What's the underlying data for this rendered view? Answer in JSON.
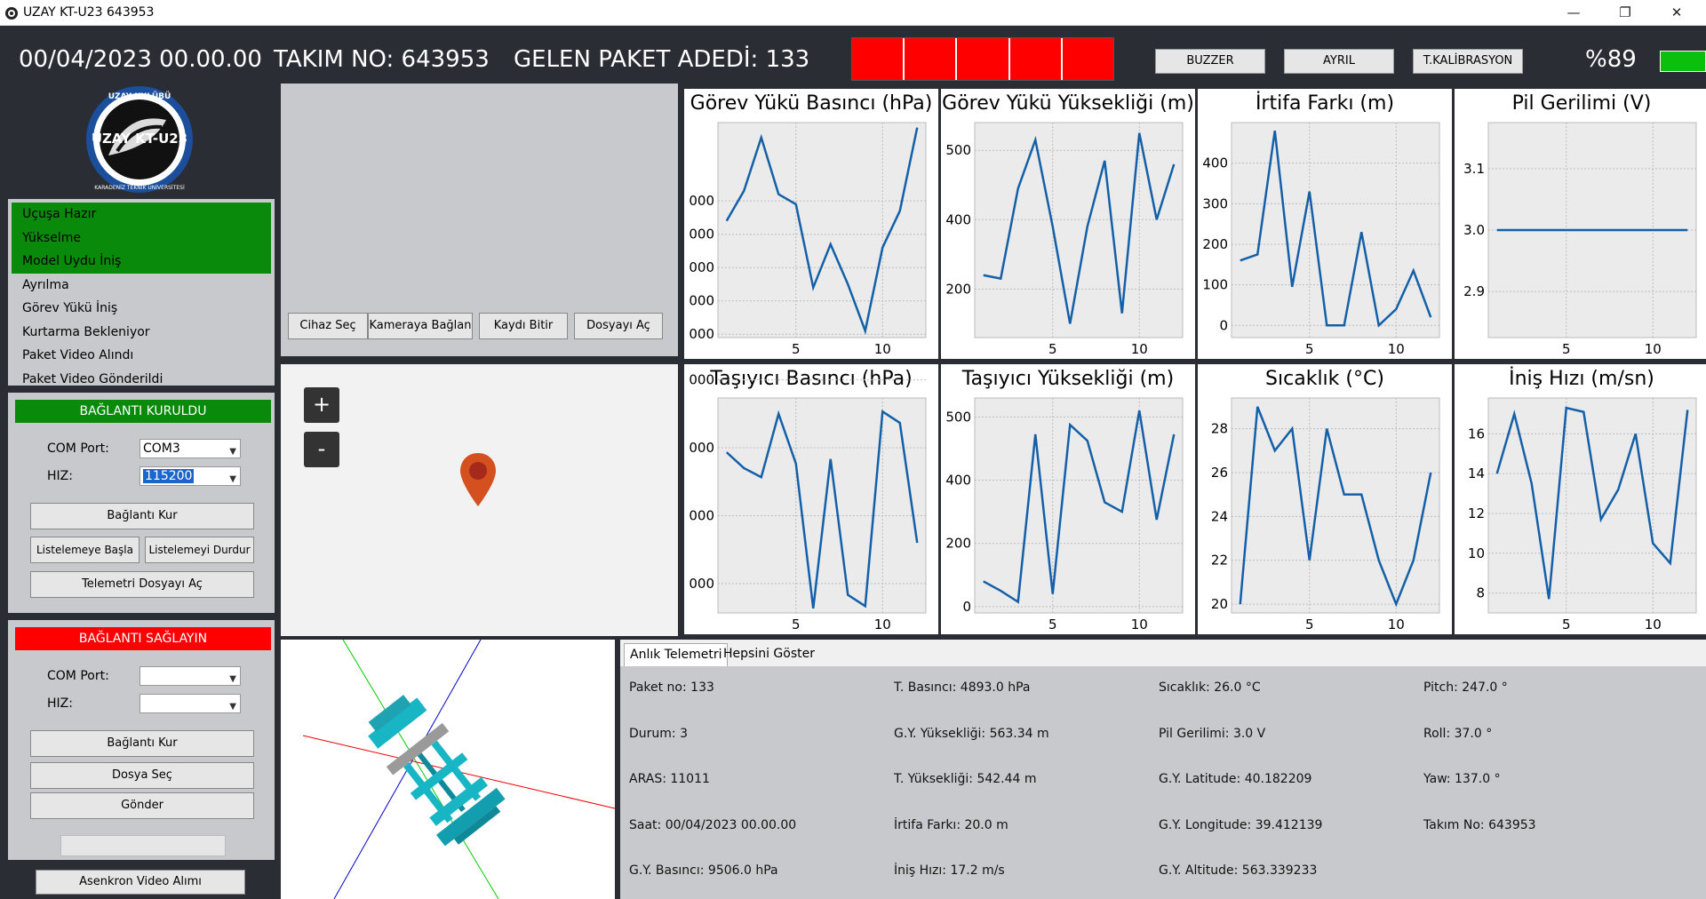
{
  "window": {
    "title": "UZAY KT-U23 643953",
    "minimize": "—",
    "restore": "❐",
    "close": "✕"
  },
  "header": {
    "datetime": "00/04/2023 00.00.00",
    "team": "TAKIM NO: 643953",
    "packets": "GELEN PAKET ADEDİ: 133",
    "buttons": {
      "buzzer": "BUZZER",
      "separate": "AYRIL",
      "calibration": "T.KALİBRASYON"
    },
    "battery": "%89",
    "status_color": "#ff0000",
    "battery_color": "#0cbf0c"
  },
  "logo": {
    "top_text": "UZAY KULÜBÜ",
    "main_text": "UZAY KT-U23",
    "ring_text": "KARADENİZ TEKNİK ÜNİVERSİTESİ"
  },
  "flight_status": {
    "items": [
      "Uçuşa Hazır",
      "Yükselme",
      "Model Uydu İniş",
      "Ayrılma",
      "Görev Yükü İniş",
      "Kurtarma Bekleniyor",
      "Paket Video Alındı",
      "Paket Video Gönderildi"
    ],
    "active_count": 3,
    "active_color": "#0a8a0a"
  },
  "connection1": {
    "status": "BAĞLANTI KURULDU",
    "status_color": "#0a8a0a",
    "com_label": "COM Port:",
    "com_value": "COM3",
    "speed_label": "HIZ:",
    "speed_value": "115200",
    "connect": "Bağlantı Kur",
    "start_list": "Listelemeye Başla",
    "stop_list": "Listelemeyi Durdur",
    "open_file": "Telemetri Dosyayı Aç"
  },
  "connection2": {
    "status": "BAĞLANTI SAĞLAYIN",
    "status_color": "#ff0000",
    "com_label": "COM Port:",
    "com_value": "",
    "speed_label": "HIZ:",
    "speed_value": "",
    "connect": "Bağlantı Kur",
    "select_file": "Dosya Seç",
    "send": "Gönder"
  },
  "async_video": "Asenkron Video Alımı",
  "camera": {
    "select_device": "Cihaz Seç",
    "connect_camera": "Kameraya Bağlan",
    "stop_record": "Kaydı Bitir",
    "open_file": "Dosyayı Aç"
  },
  "map": {
    "zoom_in": "+",
    "zoom_out": "-"
  },
  "charts": [
    {
      "title": "Görev Yükü Basıncı (hPa)",
      "x": [
        1,
        2,
        3,
        4,
        5,
        6,
        7,
        8,
        9,
        10,
        11,
        12
      ],
      "y": [
        8400,
        9300,
        10900,
        9200,
        8900,
        6400,
        7700,
        6500,
        5100,
        7600,
        8700,
        11200
      ],
      "ylim": [
        4900,
        11350
      ],
      "yticks": [
        5000,
        6000,
        7000,
        8000,
        9000
      ],
      "ytick_labels": [
        "000",
        "000",
        "000",
        "000",
        "000"
      ],
      "xticks": [
        5,
        10
      ]
    },
    {
      "title": "Görev Yükü Yüksekliği (m)",
      "x": [
        1,
        2,
        3,
        4,
        5,
        6,
        7,
        8,
        9,
        10,
        11,
        12
      ],
      "y": [
        240,
        230,
        490,
        630,
        380,
        100,
        380,
        570,
        130,
        650,
        400,
        560
      ],
      "ylim": [
        60,
        680
      ],
      "yticks": [
        200,
        400,
        600
      ],
      "ytick_labels": [
        "200",
        "400",
        "500"
      ],
      "xticks": [
        5,
        10
      ]
    },
    {
      "title": "İrtifa Farkı (m)",
      "x": [
        1,
        2,
        3,
        4,
        5,
        6,
        7,
        8,
        9,
        10,
        11,
        12
      ],
      "y": [
        160,
        175,
        480,
        95,
        330,
        0,
        0,
        230,
        0,
        40,
        135,
        20
      ],
      "ylim": [
        -30,
        500
      ],
      "yticks": [
        0,
        100,
        200,
        300,
        400
      ],
      "ytick_labels": [
        "0",
        "100",
        "200",
        "300",
        "400"
      ],
      "xticks": [
        5,
        10
      ]
    },
    {
      "title": "Pil Gerilimi (V)",
      "x": [
        1,
        2,
        3,
        4,
        5,
        6,
        7,
        8,
        9,
        10,
        11,
        12
      ],
      "y": [
        3.0,
        3.0,
        3.0,
        3.0,
        3.0,
        3.0,
        3.0,
        3.0,
        3.0,
        3.0,
        3.0,
        3.0
      ],
      "ylim": [
        2.825,
        3.175
      ],
      "yticks": [
        2.9,
        3.0,
        3.1
      ],
      "ytick_labels": [
        "2.9",
        "3.0",
        "3.1"
      ],
      "xticks": [
        5,
        10
      ]
    },
    {
      "title": "Taşıyıcı Basıncı (hPa)",
      "x": [
        1,
        2,
        3,
        4,
        5,
        6,
        7,
        8,
        9,
        10,
        11,
        12
      ],
      "y": [
        8800,
        8100,
        7700,
        10500,
        8300,
        1900,
        8500,
        2500,
        2000,
        10600,
        10100,
        4800
      ],
      "ylim": [
        1700,
        11200
      ],
      "yticks": [
        3000,
        6000,
        9000,
        12000
      ],
      "ytick_labels": [
        "000",
        "000",
        "000",
        "000"
      ],
      "xticks": [
        5,
        10
      ]
    },
    {
      "title": "Taşıyıcı Yüksekliği (m)",
      "x": [
        1,
        2,
        3,
        4,
        5,
        6,
        7,
        8,
        9,
        10,
        11,
        12
      ],
      "y": [
        80,
        50,
        15,
        545,
        40,
        575,
        525,
        330,
        300,
        620,
        275,
        545
      ],
      "ylim": [
        -20,
        660
      ],
      "yticks": [
        0,
        200,
        400,
        600
      ],
      "ytick_labels": [
        "0",
        "200",
        "400",
        "500"
      ],
      "xticks": [
        5,
        10
      ]
    },
    {
      "title": "Sıcaklık (°C)",
      "x": [
        1,
        2,
        3,
        4,
        5,
        6,
        7,
        8,
        9,
        10,
        11,
        12
      ],
      "y": [
        20,
        29,
        27,
        28,
        22,
        28,
        25,
        25,
        22,
        20,
        22,
        26
      ],
      "ylim": [
        19.6,
        29.4
      ],
      "yticks": [
        20,
        22,
        24,
        26,
        28
      ],
      "ytick_labels": [
        "20",
        "22",
        "24",
        "26",
        "28"
      ],
      "xticks": [
        5,
        10
      ]
    },
    {
      "title": "İniş Hızı (m/sn)",
      "x": [
        1,
        2,
        3,
        4,
        5,
        6,
        7,
        8,
        9,
        10,
        11,
        12
      ],
      "y": [
        14,
        17,
        13.5,
        7.7,
        17.3,
        17.1,
        11.7,
        13.2,
        16,
        10.5,
        9.5,
        17.2
      ],
      "ylim": [
        7.0,
        17.8
      ],
      "yticks": [
        8,
        10,
        12,
        14,
        16
      ],
      "ytick_labels": [
        "8",
        "10",
        "12",
        "14",
        "16"
      ],
      "xticks": [
        5,
        10
      ]
    }
  ],
  "telemetry": {
    "tabs": [
      "Anlık Telemetri",
      "Hepsini Göster"
    ],
    "col1": [
      "Paket no: 133",
      "Durum: 3",
      "ARAS: 11011",
      "Saat: 00/04/2023 00.00.00",
      "G.Y. Basıncı: 9506.0 hPa"
    ],
    "col2": [
      "T. Basıncı: 4893.0 hPa",
      "G.Y. Yüksekliği: 563.34 m",
      "T. Yüksekliği: 542.44 m",
      "İrtifa Farkı: 20.0 m",
      "İniş Hızı: 17.2 m/s"
    ],
    "col3": [
      "Sıcaklık: 26.0 °C",
      "Pil Gerilimi: 3.0 V",
      "G.Y. Latitude: 40.182209",
      "G.Y. Longitude: 39.412139",
      "G.Y. Altitude: 563.339233"
    ],
    "col4": [
      "Pitch: 247.0 °",
      "Roll: 37.0 °",
      "Yaw: 137.0 °",
      "Takım No: 643953"
    ]
  }
}
